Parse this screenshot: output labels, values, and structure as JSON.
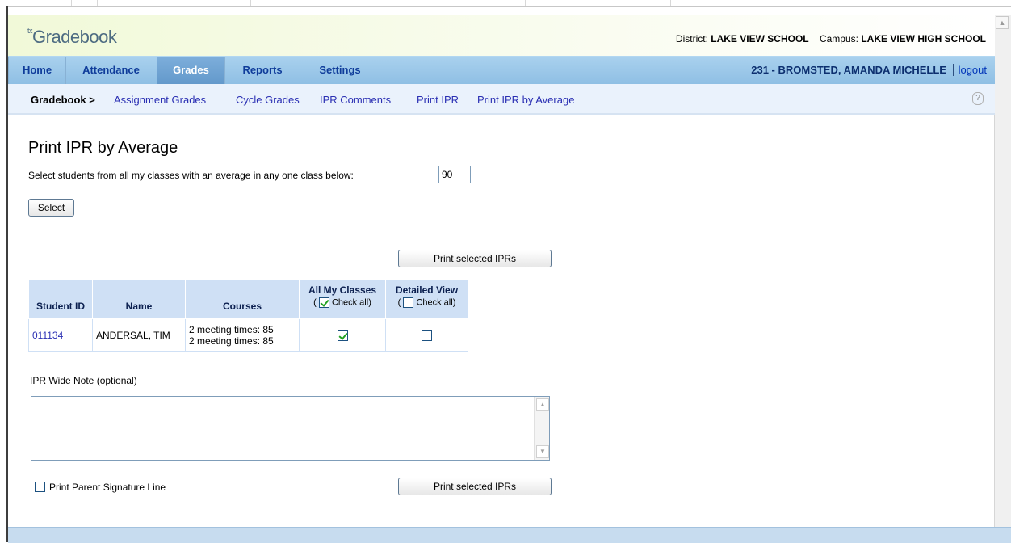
{
  "app": {
    "logo_prefix": "tx",
    "logo_text": "Gradebook",
    "district_label": "District:",
    "district_value": "LAKE VIEW SCHOOL",
    "campus_label": "Campus:",
    "campus_value": "LAKE VIEW HIGH SCHOOL"
  },
  "nav": {
    "items": [
      {
        "label": "Home"
      },
      {
        "label": "Attendance"
      },
      {
        "label": "Grades"
      },
      {
        "label": "Reports"
      },
      {
        "label": "Settings"
      }
    ],
    "active": "Grades",
    "user": "231 - BROMSTED, AMANDA MICHELLE",
    "logout": "logout"
  },
  "subnav": {
    "crumb": "Gradebook >",
    "links": [
      {
        "label": "Assignment Grades"
      },
      {
        "label": "Cycle Grades"
      },
      {
        "label": "IPR Comments"
      },
      {
        "label": "Print IPR"
      },
      {
        "label": "Print IPR by Average"
      }
    ]
  },
  "page": {
    "title": "Print IPR by Average",
    "filter_text": "Select students from all my classes with an average in any one class below:",
    "average_value": "90",
    "select_button": "Select",
    "print_button": "Print selected IPRs",
    "note_label": "IPR Wide Note (optional)",
    "note_value": "",
    "signature_label": "Print Parent Signature Line",
    "signature_checked": false
  },
  "table": {
    "headers": {
      "student_id": "Student ID",
      "name": "Name",
      "courses": "Courses",
      "all_classes": "All My Classes",
      "detailed_view": "Detailed View",
      "check_all": "Check all",
      "paren_open": "(",
      "paren_close": ")"
    },
    "all_classes_checkall": true,
    "detailed_checkall": false,
    "rows": [
      {
        "student_id": "011134",
        "name": "ANDERSAL, TIM",
        "courses": [
          "2 meeting times: 85",
          "2 meeting times: 85"
        ],
        "all_classes": true,
        "detailed": false
      }
    ]
  },
  "colors": {
    "link": "#2a2fb3",
    "nav_text": "#0f3c9a",
    "nav_active_bg": "#6399cb",
    "table_header_bg": "#cfe0f5",
    "check_green": "#21a121"
  }
}
